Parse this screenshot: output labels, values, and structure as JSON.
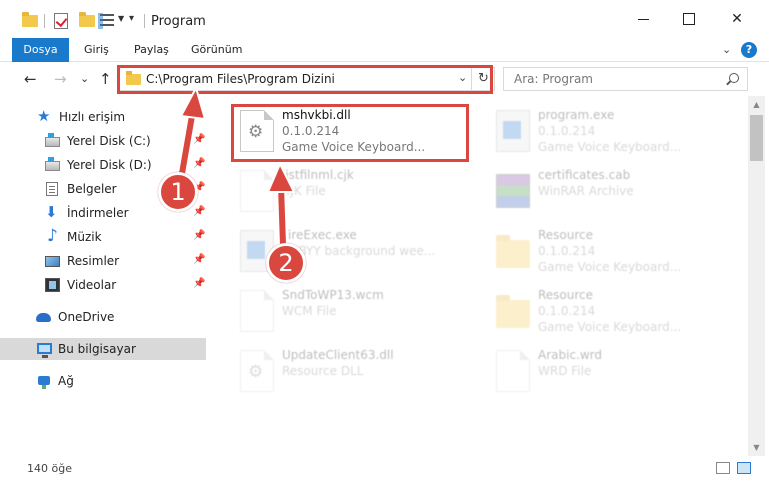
{
  "window": {
    "title": "Program",
    "minimize_icon": "minimize-icon",
    "maximize_icon": "maximize-icon",
    "close_glyph": "✕"
  },
  "ribbon": {
    "tabs": [
      {
        "label": "Dosya",
        "active": true
      },
      {
        "label": "Giriş"
      },
      {
        "label": "Paylaş"
      },
      {
        "label": "Görünüm"
      }
    ],
    "expand_glyph": "⌄",
    "help_glyph": "?"
  },
  "nav": {
    "back_glyph": "←",
    "forward_glyph": "→",
    "recent_glyph": "⌄",
    "up_glyph": "↑",
    "address": "C:\\Program Files\\Program Dizini",
    "address_drop_glyph": "⌄",
    "refresh_glyph": "↻",
    "search_placeholder": "Ara: Program"
  },
  "sidebar": {
    "items": [
      {
        "label": "Hızlı erişim",
        "icon": "star-icon"
      },
      {
        "label": "Yerel Disk (C:)",
        "icon": "disk-icon",
        "pinned": true
      },
      {
        "label": "Yerel Disk (D:)",
        "icon": "disk-icon",
        "pinned": true
      },
      {
        "label": "Belgeler",
        "icon": "documents-icon",
        "pinned": true
      },
      {
        "label": "İndirmeler",
        "icon": "downloads-icon",
        "pinned": true
      },
      {
        "label": "Müzik",
        "icon": "music-icon",
        "pinned": true
      },
      {
        "label": "Resimler",
        "icon": "pictures-icon",
        "pinned": true
      },
      {
        "label": "Videolar",
        "icon": "videos-icon",
        "pinned": true
      },
      {
        "label": "OneDrive",
        "icon": "onedrive-icon"
      },
      {
        "label": "Bu bilgisayar",
        "icon": "this-pc-icon",
        "selected": true
      },
      {
        "label": "Ağ",
        "icon": "network-icon"
      }
    ],
    "pin_glyph": "📌"
  },
  "files": [
    {
      "name": "mshvkbi.dll",
      "line2": "0.1.0.214",
      "line3": "Game Voice Keyboard...",
      "icon": "dll-icon",
      "highlight": true
    },
    {
      "name": "program.exe",
      "line2": "0.1.0.214",
      "line3": "Game Voice Keyboard...",
      "icon": "exe-icon"
    },
    {
      "name": "listfilnml.cjk",
      "line2": "CJK File",
      "icon": "file-icon"
    },
    {
      "name": "certificates.cab",
      "line2": "WinRAR Archive",
      "icon": "rar-icon"
    },
    {
      "name": "FireExec.exe",
      "line2": "ABBYY background wee...",
      "icon": "exe-icon"
    },
    {
      "name": "Resource",
      "line2": "0.1.0.214",
      "line3": "Game Voice Keyboard...",
      "icon": "folder-icon"
    },
    {
      "name": "SndToWP13.wcm",
      "line2": "WCM File",
      "icon": "file-icon"
    },
    {
      "name": "Resource",
      "line2": "0.1.0.214",
      "line3": "Game Voice Keyboard...",
      "icon": "folder-icon"
    },
    {
      "name": "UpdateClient63.dll",
      "line2": "Resource DLL",
      "icon": "dll-icon"
    },
    {
      "name": "Arabic.wrd",
      "line2": "WRD File",
      "icon": "file-icon"
    }
  ],
  "status": {
    "count": "140 öğe"
  },
  "annotations": {
    "step1": "1",
    "step2": "2",
    "highlight_color": "#d9473f"
  }
}
